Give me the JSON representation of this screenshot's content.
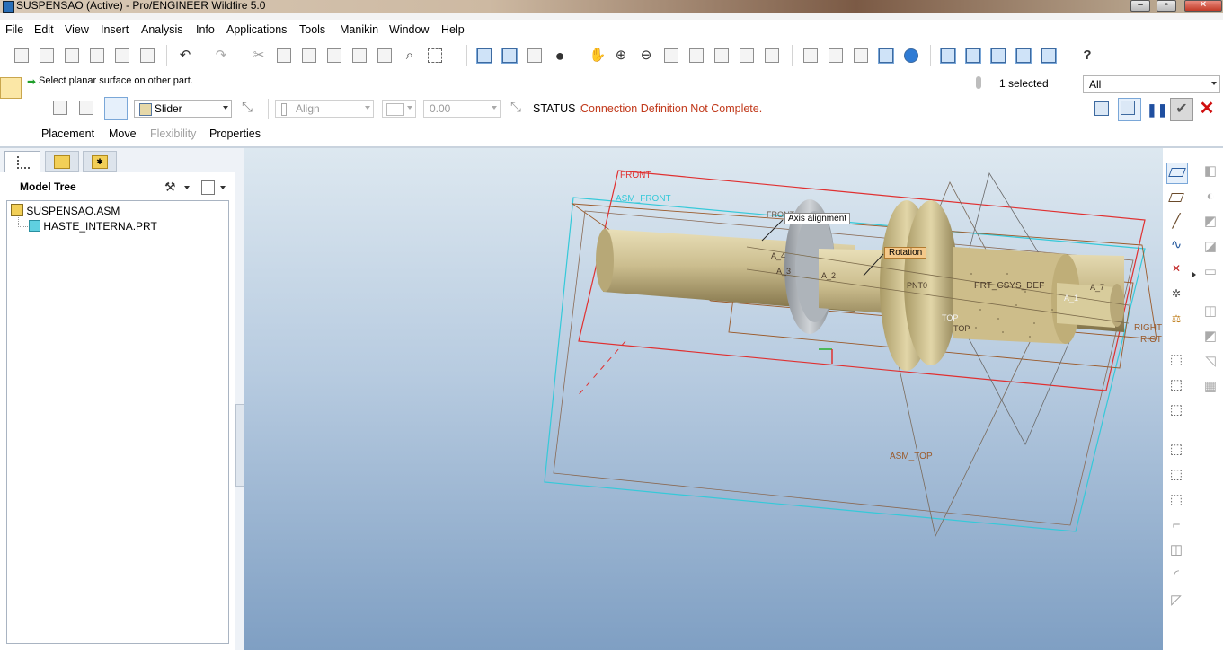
{
  "window": {
    "title": "SUSPENSAO (Active) - Pro/ENGINEER Wildfire 5.0"
  },
  "menu": [
    "File",
    "Edit",
    "View",
    "Insert",
    "Analysis",
    "Info",
    "Applications",
    "Tools",
    "Manikin",
    "Window",
    "Help"
  ],
  "prompt": {
    "message": "Select planar surface on other part."
  },
  "selection": {
    "count_label": "1 selected",
    "filter_value": "All"
  },
  "dashboard": {
    "connection_type": "Slider",
    "constraint_type": "Align",
    "offset_value": "0.00",
    "status_label": "STATUS :",
    "status_message": "Connection Definition Not Complete.",
    "tabs": [
      "Placement",
      "Move",
      "Flexibility",
      "Properties"
    ]
  },
  "model_tree": {
    "title": "Model Tree",
    "items": [
      {
        "name": "SUSPENSAO.ASM",
        "level": 0
      },
      {
        "name": "HASTE_INTERNA.PRT",
        "level": 1
      }
    ]
  },
  "viewport": {
    "labels": {
      "front": "FRONT",
      "asm_front": "ASM_FRONT",
      "asm_top": "ASM_TOP",
      "front2": "FRONT",
      "axis_alignment": "Axis alignment",
      "rotation": "Rotation",
      "a4": "A_4",
      "a3": "A_3",
      "a2": "A_2",
      "a1": "A_1",
      "a7": "A_7",
      "pnt0": "PNT0",
      "prt_csys": "PRT_CSYS_DEF",
      "top1": "TOP",
      "top2": "TOP",
      "right1": "RIGHT",
      "right2": "RIGT"
    }
  },
  "colors": {
    "status_error": "#c1391b",
    "datum_red": "#e03030",
    "datum_cyan": "#35c9d9",
    "datum_brown": "#9b5a2a",
    "part_tan": "#c8b98a",
    "tag_orange": "#f5c98a",
    "cancel_red": "#d01010"
  }
}
